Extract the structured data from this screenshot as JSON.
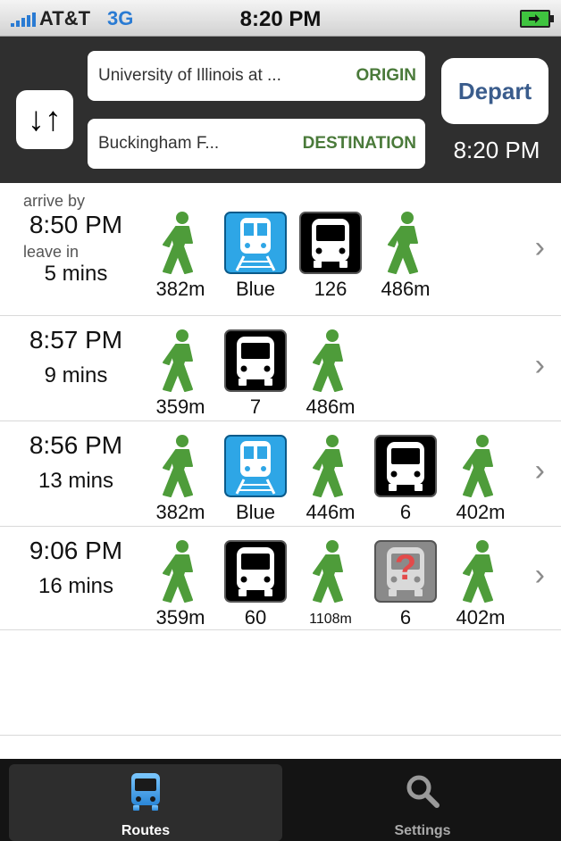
{
  "status_bar": {
    "carrier": "AT&T",
    "network": "3G",
    "time": "8:20 PM"
  },
  "header": {
    "origin": {
      "value": "University of Illinois at ...",
      "tag": "ORIGIN"
    },
    "destination": {
      "value": "Buckingham F...",
      "tag": "DESTINATION"
    },
    "depart_label": "Depart",
    "depart_time": "8:20 PM"
  },
  "routes": [
    {
      "arrive_label": "arrive by",
      "time": "8:50 PM",
      "leave_label": "leave in",
      "mins": "5 mins",
      "legs": [
        {
          "mode": "walk",
          "label": "382m"
        },
        {
          "mode": "train",
          "label": "Blue"
        },
        {
          "mode": "bus",
          "label": "126"
        },
        {
          "mode": "walk",
          "label": "486m"
        }
      ]
    },
    {
      "arrive_label": "",
      "time": "8:57 PM",
      "leave_label": "",
      "mins": "9 mins",
      "legs": [
        {
          "mode": "walk",
          "label": "359m"
        },
        {
          "mode": "bus",
          "label": "7"
        },
        {
          "mode": "walk",
          "label": "486m"
        }
      ]
    },
    {
      "arrive_label": "",
      "time": "8:56 PM",
      "leave_label": "",
      "mins": "13 mins",
      "legs": [
        {
          "mode": "walk",
          "label": "382m"
        },
        {
          "mode": "train",
          "label": "Blue"
        },
        {
          "mode": "walk",
          "label": "446m"
        },
        {
          "mode": "bus",
          "label": "6"
        },
        {
          "mode": "walk",
          "label": "402m"
        }
      ]
    },
    {
      "arrive_label": "",
      "time": "9:06 PM",
      "leave_label": "",
      "mins": "16 mins",
      "legs": [
        {
          "mode": "walk",
          "label": "359m"
        },
        {
          "mode": "bus",
          "label": "60"
        },
        {
          "mode": "walk",
          "label": "1108m"
        },
        {
          "mode": "bus-unknown",
          "label": "6"
        },
        {
          "mode": "walk",
          "label": "402m"
        }
      ]
    }
  ],
  "tabs": [
    {
      "label": "Routes",
      "icon": "bus-icon",
      "selected": true
    },
    {
      "label": "Settings",
      "icon": "search-icon",
      "selected": false
    }
  ],
  "colors": {
    "walk": "#4e9c3a",
    "train_bg": "#2ea6e6",
    "bus_bg": "#000000",
    "unknown_bg": "#8a8a8a",
    "tag": "#4a7a3a",
    "depart": "#3a5c8c"
  }
}
